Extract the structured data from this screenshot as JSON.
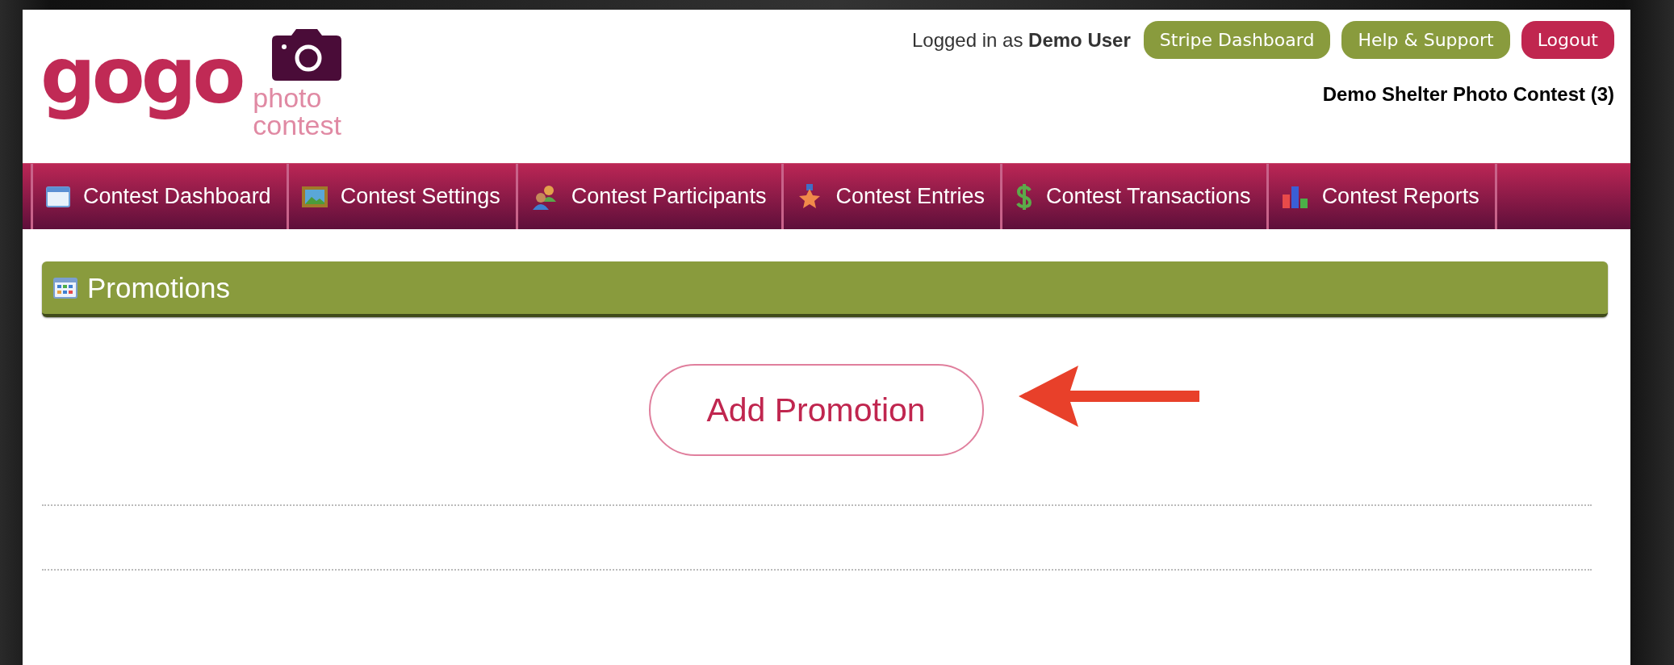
{
  "logo": {
    "wordmark": "gogo",
    "line_1": "photo",
    "line_2": "contest"
  },
  "account": {
    "prefix": "Logged in as",
    "user": "Demo User"
  },
  "header_buttons": [
    {
      "label": "Stripe Dashboard",
      "kind": "neutral"
    },
    {
      "label": "Help & Support",
      "kind": "neutral"
    },
    {
      "label": "Logout",
      "kind": "danger"
    }
  ],
  "contest_title": "Demo Shelter Photo Contest (3)",
  "nav": [
    {
      "label": "Contest Dashboard"
    },
    {
      "label": "Contest Settings"
    },
    {
      "label": "Contest Participants"
    },
    {
      "label": "Contest Entries"
    },
    {
      "label": "Contest Transactions"
    },
    {
      "label": "Contest Reports"
    }
  ],
  "section": {
    "title": "Promotions"
  },
  "add_button": {
    "label": "Add Promotion"
  }
}
